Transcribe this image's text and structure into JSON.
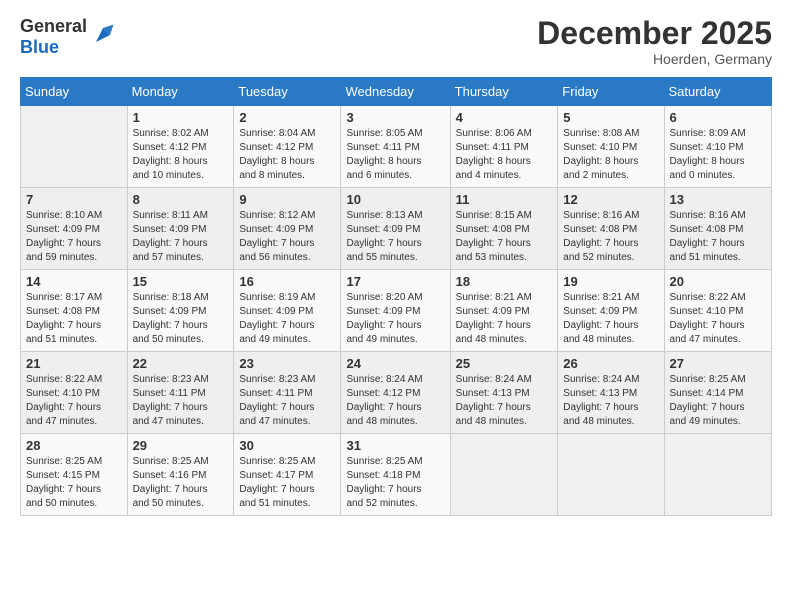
{
  "header": {
    "logo_general": "General",
    "logo_blue": "Blue",
    "month_title": "December 2025",
    "location": "Hoerden, Germany"
  },
  "days_of_week": [
    "Sunday",
    "Monday",
    "Tuesday",
    "Wednesday",
    "Thursday",
    "Friday",
    "Saturday"
  ],
  "weeks": [
    [
      {
        "day": "",
        "info": ""
      },
      {
        "day": "1",
        "info": "Sunrise: 8:02 AM\nSunset: 4:12 PM\nDaylight: 8 hours\nand 10 minutes."
      },
      {
        "day": "2",
        "info": "Sunrise: 8:04 AM\nSunset: 4:12 PM\nDaylight: 8 hours\nand 8 minutes."
      },
      {
        "day": "3",
        "info": "Sunrise: 8:05 AM\nSunset: 4:11 PM\nDaylight: 8 hours\nand 6 minutes."
      },
      {
        "day": "4",
        "info": "Sunrise: 8:06 AM\nSunset: 4:11 PM\nDaylight: 8 hours\nand 4 minutes."
      },
      {
        "day": "5",
        "info": "Sunrise: 8:08 AM\nSunset: 4:10 PM\nDaylight: 8 hours\nand 2 minutes."
      },
      {
        "day": "6",
        "info": "Sunrise: 8:09 AM\nSunset: 4:10 PM\nDaylight: 8 hours\nand 0 minutes."
      }
    ],
    [
      {
        "day": "7",
        "info": "Sunrise: 8:10 AM\nSunset: 4:09 PM\nDaylight: 7 hours\nand 59 minutes."
      },
      {
        "day": "8",
        "info": "Sunrise: 8:11 AM\nSunset: 4:09 PM\nDaylight: 7 hours\nand 57 minutes."
      },
      {
        "day": "9",
        "info": "Sunrise: 8:12 AM\nSunset: 4:09 PM\nDaylight: 7 hours\nand 56 minutes."
      },
      {
        "day": "10",
        "info": "Sunrise: 8:13 AM\nSunset: 4:09 PM\nDaylight: 7 hours\nand 55 minutes."
      },
      {
        "day": "11",
        "info": "Sunrise: 8:15 AM\nSunset: 4:08 PM\nDaylight: 7 hours\nand 53 minutes."
      },
      {
        "day": "12",
        "info": "Sunrise: 8:16 AM\nSunset: 4:08 PM\nDaylight: 7 hours\nand 52 minutes."
      },
      {
        "day": "13",
        "info": "Sunrise: 8:16 AM\nSunset: 4:08 PM\nDaylight: 7 hours\nand 51 minutes."
      }
    ],
    [
      {
        "day": "14",
        "info": "Sunrise: 8:17 AM\nSunset: 4:08 PM\nDaylight: 7 hours\nand 51 minutes."
      },
      {
        "day": "15",
        "info": "Sunrise: 8:18 AM\nSunset: 4:09 PM\nDaylight: 7 hours\nand 50 minutes."
      },
      {
        "day": "16",
        "info": "Sunrise: 8:19 AM\nSunset: 4:09 PM\nDaylight: 7 hours\nand 49 minutes."
      },
      {
        "day": "17",
        "info": "Sunrise: 8:20 AM\nSunset: 4:09 PM\nDaylight: 7 hours\nand 49 minutes."
      },
      {
        "day": "18",
        "info": "Sunrise: 8:21 AM\nSunset: 4:09 PM\nDaylight: 7 hours\nand 48 minutes."
      },
      {
        "day": "19",
        "info": "Sunrise: 8:21 AM\nSunset: 4:09 PM\nDaylight: 7 hours\nand 48 minutes."
      },
      {
        "day": "20",
        "info": "Sunrise: 8:22 AM\nSunset: 4:10 PM\nDaylight: 7 hours\nand 47 minutes."
      }
    ],
    [
      {
        "day": "21",
        "info": "Sunrise: 8:22 AM\nSunset: 4:10 PM\nDaylight: 7 hours\nand 47 minutes."
      },
      {
        "day": "22",
        "info": "Sunrise: 8:23 AM\nSunset: 4:11 PM\nDaylight: 7 hours\nand 47 minutes."
      },
      {
        "day": "23",
        "info": "Sunrise: 8:23 AM\nSunset: 4:11 PM\nDaylight: 7 hours\nand 47 minutes."
      },
      {
        "day": "24",
        "info": "Sunrise: 8:24 AM\nSunset: 4:12 PM\nDaylight: 7 hours\nand 48 minutes."
      },
      {
        "day": "25",
        "info": "Sunrise: 8:24 AM\nSunset: 4:13 PM\nDaylight: 7 hours\nand 48 minutes."
      },
      {
        "day": "26",
        "info": "Sunrise: 8:24 AM\nSunset: 4:13 PM\nDaylight: 7 hours\nand 48 minutes."
      },
      {
        "day": "27",
        "info": "Sunrise: 8:25 AM\nSunset: 4:14 PM\nDaylight: 7 hours\nand 49 minutes."
      }
    ],
    [
      {
        "day": "28",
        "info": "Sunrise: 8:25 AM\nSunset: 4:15 PM\nDaylight: 7 hours\nand 50 minutes."
      },
      {
        "day": "29",
        "info": "Sunrise: 8:25 AM\nSunset: 4:16 PM\nDaylight: 7 hours\nand 50 minutes."
      },
      {
        "day": "30",
        "info": "Sunrise: 8:25 AM\nSunset: 4:17 PM\nDaylight: 7 hours\nand 51 minutes."
      },
      {
        "day": "31",
        "info": "Sunrise: 8:25 AM\nSunset: 4:18 PM\nDaylight: 7 hours\nand 52 minutes."
      },
      {
        "day": "",
        "info": ""
      },
      {
        "day": "",
        "info": ""
      },
      {
        "day": "",
        "info": ""
      }
    ]
  ]
}
